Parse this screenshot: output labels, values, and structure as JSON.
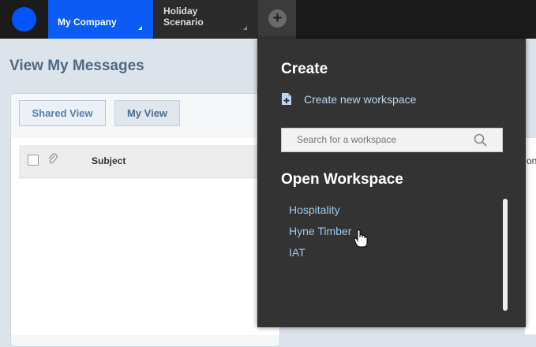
{
  "topbar": {
    "tabs": [
      {
        "label": "My Company"
      },
      {
        "label_line1": "Holiday",
        "label_line2": "Scenario"
      }
    ],
    "add_label": "+"
  },
  "main": {
    "title": "View My Messages",
    "view_buttons": {
      "shared": "Shared View",
      "mine": "My View"
    },
    "table": {
      "columns": [
        "Subject"
      ],
      "cut_column_fragment": "on"
    }
  },
  "dropdown": {
    "create_heading": "Create",
    "create_link": "Create new workspace",
    "search": {
      "placeholder": "Search for a workspace"
    },
    "open_heading": "Open Workspace",
    "workspaces": [
      "Hospitality",
      "Hyne Timber",
      "IAT"
    ]
  },
  "colors": {
    "brand_blue": "#0a5cf5",
    "link_blue": "#9ec8ee",
    "dropdown_bg": "#333333"
  }
}
